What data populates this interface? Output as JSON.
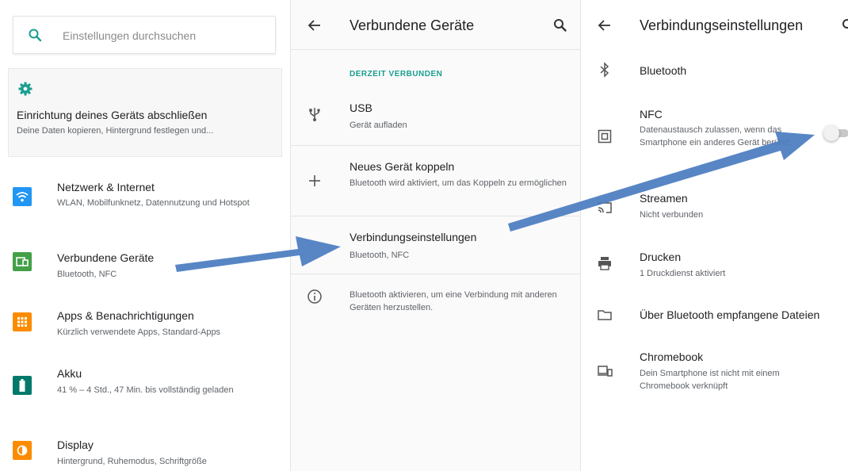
{
  "panel1": {
    "search_placeholder": "Einstellungen durchsuchen",
    "setup": {
      "title": "Einrichtung deines Geräts abschließen",
      "subtitle": "Deine Daten kopieren, Hintergrund festlegen und..."
    },
    "categories": [
      {
        "title": "Netzwerk & Internet",
        "subtitle": "WLAN, Mobilfunknetz, Datennutzung und Hotspot",
        "icon": "wifi-icon",
        "color": "#2196f3"
      },
      {
        "title": "Verbundene Geräte",
        "subtitle": "Bluetooth, NFC",
        "icon": "devices-icon",
        "color": "#43a047"
      },
      {
        "title": "Apps & Benachrichtigungen",
        "subtitle": "Kürzlich verwendete Apps, Standard-Apps",
        "icon": "apps-icon",
        "color": "#fb8c00"
      },
      {
        "title": "Akku",
        "subtitle": "41 % – 4 Std., 47 Min. bis vollständig geladen",
        "icon": "battery-icon",
        "color": "#00796b"
      },
      {
        "title": "Display",
        "subtitle": "Hintergrund, Ruhemodus, Schriftgröße",
        "icon": "display-icon",
        "color": "#fb8c00"
      }
    ]
  },
  "panel2": {
    "title": "Verbundene Geräte",
    "section": "DERZEIT VERBUNDEN",
    "items": [
      {
        "title": "USB",
        "subtitle": "Gerät aufladen",
        "icon": "usb-icon"
      },
      {
        "title": "Neues Gerät koppeln",
        "subtitle": "Bluetooth wird aktiviert, um das Koppeln zu ermöglichen",
        "icon": "plus-icon"
      },
      {
        "title": "Verbindungseinstellungen",
        "subtitle": "Bluetooth, NFC",
        "icon": ""
      }
    ],
    "info": "Bluetooth aktivieren, um eine Verbindung mit anderen Geräten herzustellen."
  },
  "panel3": {
    "title": "Verbindungseinstellungen",
    "items": [
      {
        "title": "Bluetooth",
        "subtitle": "",
        "icon": "bluetooth-icon"
      },
      {
        "title": "NFC",
        "subtitle": "Datenaustausch zulassen, wenn das Smartphone ein anderes Gerät berührt",
        "icon": "nfc-icon"
      },
      {
        "title": "Streamen",
        "subtitle": "Nicht verbunden",
        "icon": "cast-icon"
      },
      {
        "title": "Drucken",
        "subtitle": "1 Druckdienst aktiviert",
        "icon": "print-icon"
      },
      {
        "title": "Über Bluetooth empfangene Dateien",
        "subtitle": "",
        "icon": "folder-icon"
      },
      {
        "title": "Chromebook",
        "subtitle": "Dein Smartphone ist nicht mit einem Chromebook verknüpft",
        "icon": "chromebook-icon"
      }
    ],
    "nfc_enabled": false
  },
  "colors": {
    "accent": "#1a9e8f",
    "arrow": "#4a7cc0"
  }
}
